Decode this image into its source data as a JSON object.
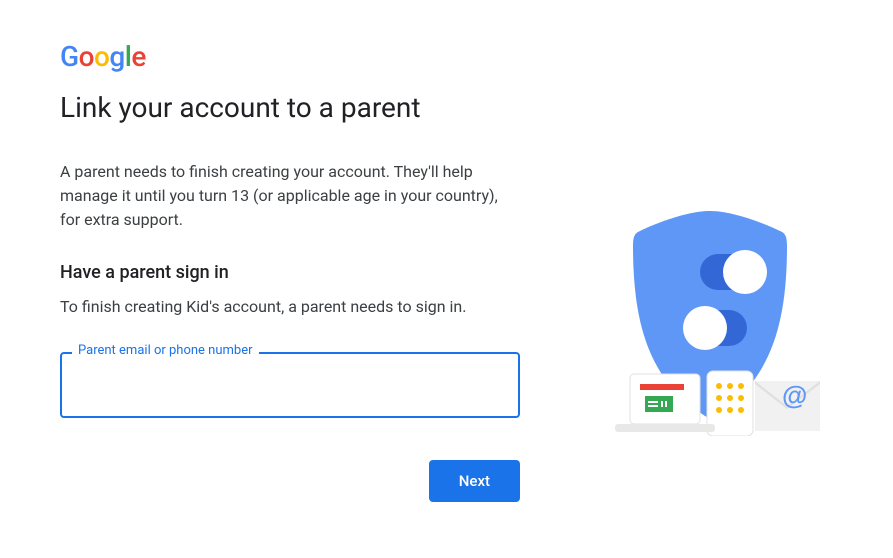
{
  "logo": {
    "text": "Google"
  },
  "page": {
    "title": "Link your account to a parent",
    "description": "A parent needs to finish creating your account. They'll help manage it until you turn 13 (or applicable age in your country), for extra support.",
    "subheading": "Have a parent sign in",
    "subtext": "To finish creating Kid's account, a parent needs to sign in."
  },
  "form": {
    "parent_input_label": "Parent email or phone number",
    "parent_input_value": "",
    "next_button_label": "Next"
  },
  "illustration": {
    "name": "family-link-shield-illustration"
  }
}
